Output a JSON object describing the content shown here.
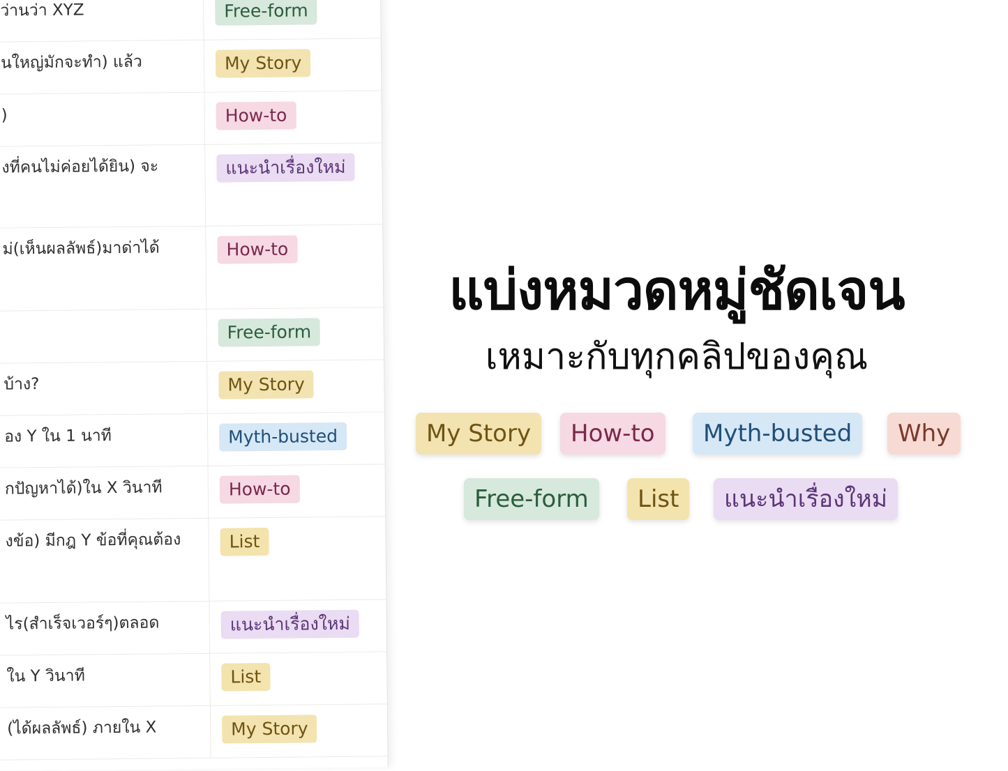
{
  "table": {
    "rows": [
      {
        "text": "ว่านว่า XYZ",
        "tag": "Free-form",
        "color": "free",
        "h": 74
      },
      {
        "text": "นใหญ่มักจะทำ) แล้ว",
        "tag": "My Story",
        "color": "story",
        "h": 74
      },
      {
        "text": ")",
        "tag": "How-to",
        "color": "how",
        "h": 74
      },
      {
        "text": "งที่คนไม่ค่อยได้ยิน) จะ",
        "tag": "แนะนำเรื่องใหม่",
        "color": "new",
        "h": 116
      },
      {
        "text": "ม่(เห็นผลลัพธ์)มาด่าได้",
        "tag": "How-to",
        "color": "how",
        "h": 118
      },
      {
        "text": "",
        "tag": "Free-form",
        "color": "free",
        "h": 74
      },
      {
        "text": "บ้าง?",
        "tag": "My Story",
        "color": "story",
        "h": 74
      },
      {
        "text": "อง Y ใน 1 นาที",
        "tag": "Myth-busted",
        "color": "myth",
        "h": 74
      },
      {
        "text": "กปัญหาได้)ใน X วินาที",
        "tag": "How-to",
        "color": "how",
        "h": 74
      },
      {
        "text": "งข้อ)  มีกฎ Y ข้อที่คุณต้อง",
        "tag": "List",
        "color": "list",
        "h": 118
      },
      {
        "text": "ไร(สำเร็จเวอร์ๆ)ตลอด",
        "tag": "แนะนำเรื่องใหม่",
        "color": "new",
        "h": 74
      },
      {
        "text": "ใน Y วินาที",
        "tag": "List",
        "color": "list",
        "h": 74
      },
      {
        "text": "(ได้ผลลัพธ์) ภายใน X",
        "tag": "My Story",
        "color": "story",
        "h": 74
      }
    ]
  },
  "hero": {
    "headline": "แบ่งหมวดหมู่ชัดเจน",
    "subhead": "เหมาะกับทุกคลิปของคุณ",
    "pills_row1": [
      {
        "label": "My Story",
        "color": "story"
      },
      {
        "label": "How-to",
        "color": "how"
      },
      {
        "label": "Myth-busted",
        "color": "myth"
      },
      {
        "label": "Why",
        "color": "why"
      }
    ],
    "pills_row2": [
      {
        "label": "Free-form",
        "color": "free"
      },
      {
        "label": "List",
        "color": "list"
      },
      {
        "label": "แนะนำเรื่องใหม่",
        "color": "new"
      }
    ]
  }
}
